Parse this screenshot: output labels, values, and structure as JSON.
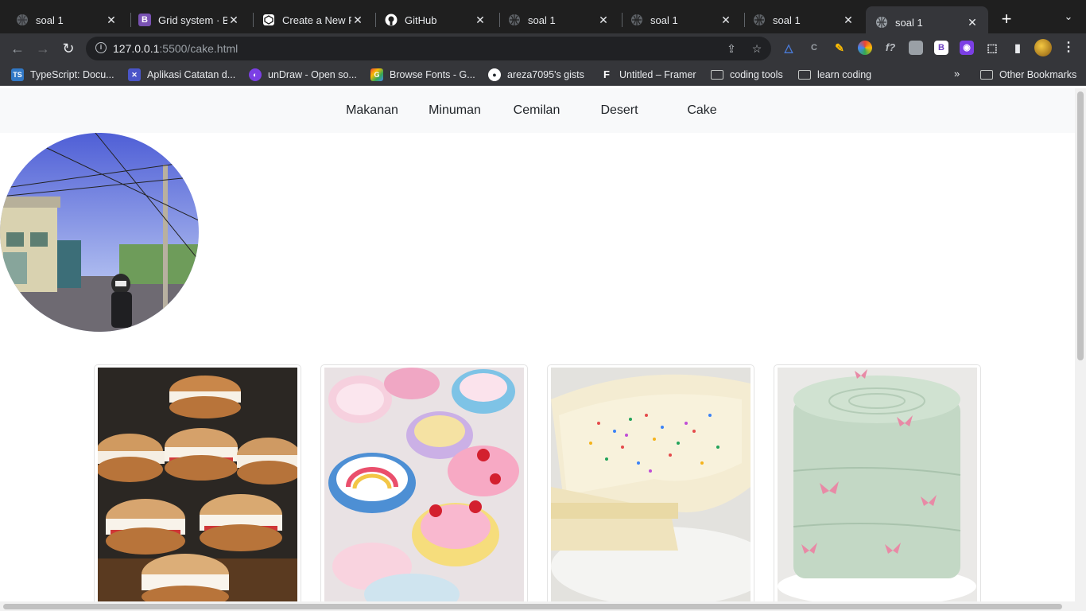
{
  "tabs": [
    {
      "title": "soal 1",
      "icon": "globe-icon"
    },
    {
      "title": "Grid system · Bootstrap",
      "icon": "bootstrap-icon"
    },
    {
      "title": "Create a New Pen",
      "icon": "codepen-icon"
    },
    {
      "title": "GitHub",
      "icon": "github-icon"
    },
    {
      "title": "soal 1",
      "icon": "globe-icon"
    },
    {
      "title": "soal 1",
      "icon": "globe-icon"
    },
    {
      "title": "soal 1",
      "icon": "globe-icon"
    },
    {
      "title": "soal 1",
      "icon": "globe-icon",
      "active": true
    }
  ],
  "address": {
    "host": "127.0.0.1",
    "path": ":5500/cake.html"
  },
  "bookmarks": [
    {
      "label": "TypeScript: Docu...",
      "badge": "TS",
      "color": "#3178c6"
    },
    {
      "label": "Aplikasi Catatan d...",
      "badge": "✕",
      "color": "#4a55c8"
    },
    {
      "label": "unDraw - Open so...",
      "badge": "◐",
      "color": "#7b3fe4"
    },
    {
      "label": "Browse Fonts - G...",
      "badge": "G",
      "color": "#ea4335"
    },
    {
      "label": "areza7095's gists",
      "badge": "●",
      "color": "#24292f"
    },
    {
      "label": "Untitled – Framer",
      "badge": "F",
      "color": "#111"
    },
    {
      "label": "coding tools",
      "badge": "",
      "color": ""
    },
    {
      "label": "learn coding",
      "badge": "",
      "color": ""
    }
  ],
  "other_bookmarks": "Other Bookmarks",
  "nav": {
    "items": [
      "Makanan",
      "Minuman",
      "Cemilan",
      "Desert",
      "Cake"
    ]
  },
  "cards": [
    {
      "subject": "powdered cream donuts with strawberries"
    },
    {
      "subject": "colorful decorated mini cakes"
    },
    {
      "subject": "sprinkle funfetti cake slice"
    },
    {
      "subject": "mint green cake with pink butterflies"
    }
  ],
  "colors": {
    "navbar_bg": "#f8f9fa",
    "tab_bar": "#1f1f1f",
    "toolbar": "#35363a"
  }
}
